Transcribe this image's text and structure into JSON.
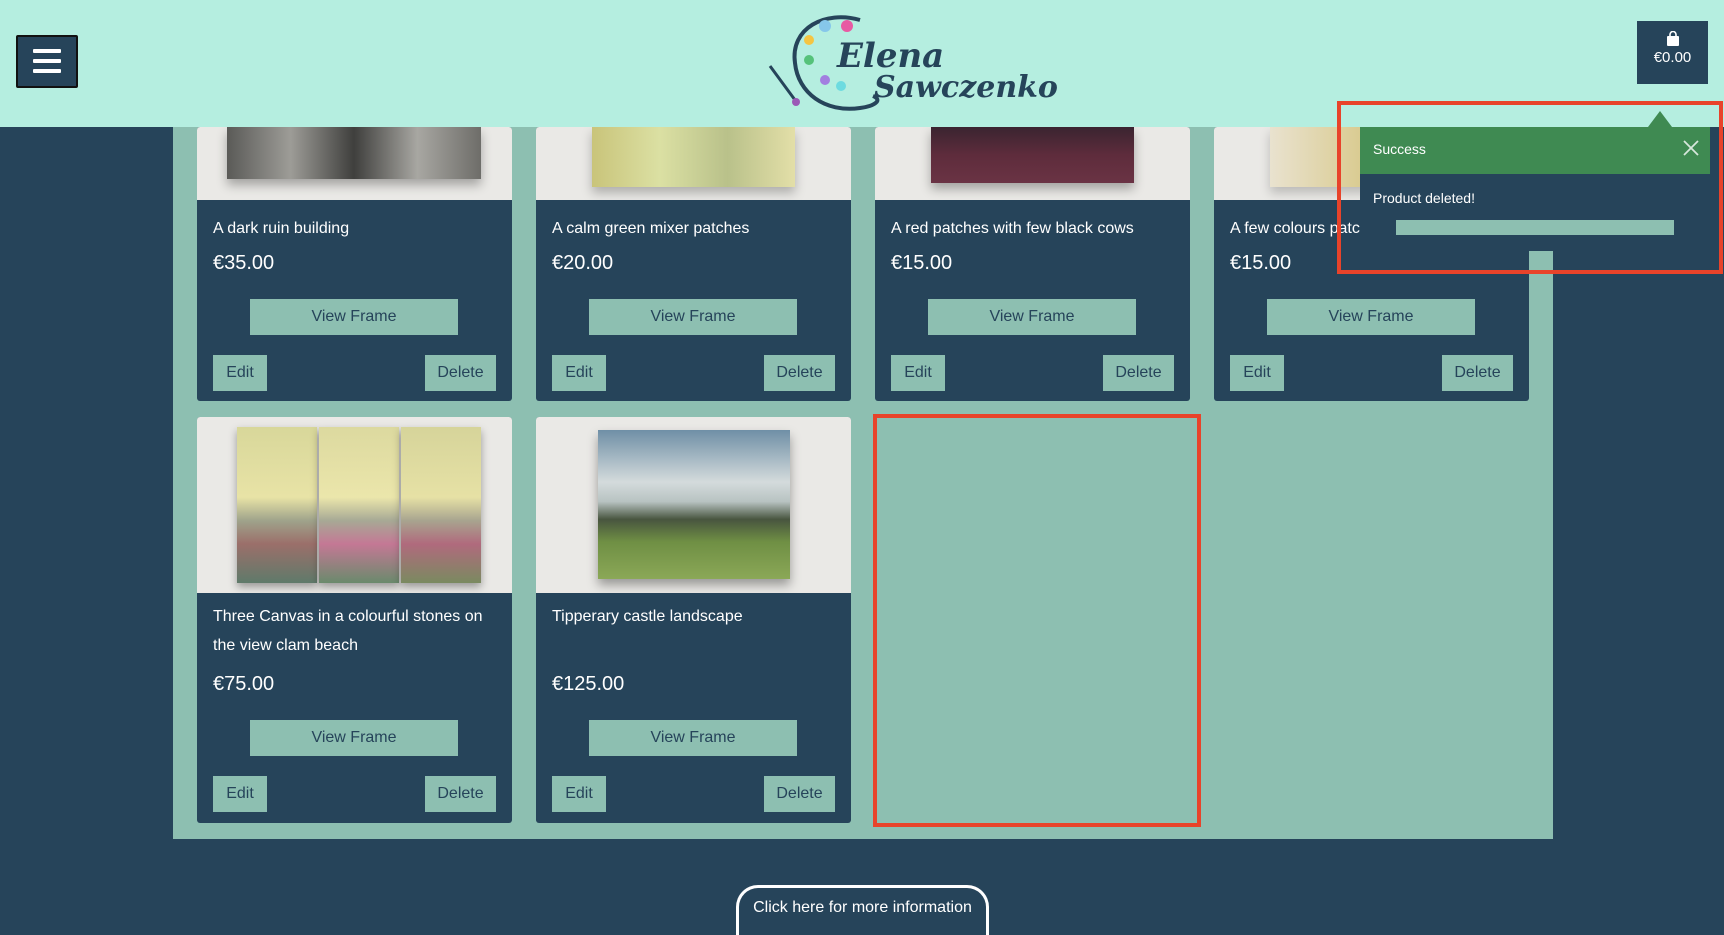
{
  "header": {
    "logo_line1": "Elena",
    "logo_line2": "Sawczenko",
    "cart_total": "€0.00",
    "icons": [
      "menu-icon",
      "shopping-bag-icon",
      "palette-icon"
    ]
  },
  "products": [
    {
      "title": "A dark ruin building",
      "price": "€35.00",
      "view_label": "View Frame",
      "edit_label": "Edit",
      "delete_label": "Delete"
    },
    {
      "title": "A calm green mixer patches",
      "price": "€20.00",
      "view_label": "View Frame",
      "edit_label": "Edit",
      "delete_label": "Delete"
    },
    {
      "title": "A red patches with few black cows",
      "price": "€15.00",
      "view_label": "View Frame",
      "edit_label": "Edit",
      "delete_label": "Delete"
    },
    {
      "title": "A few colours patc",
      "price": "€15.00",
      "view_label": "View Frame",
      "edit_label": "Edit",
      "delete_label": "Delete"
    },
    {
      "title": "Three Canvas in a colourful stones on the view clam beach",
      "price": "€75.00",
      "view_label": "View Frame",
      "edit_label": "Edit",
      "delete_label": "Delete"
    },
    {
      "title": "Tipperary castle landscape",
      "price": "€125.00",
      "view_label": "View Frame",
      "edit_label": "Edit",
      "delete_label": "Delete"
    }
  ],
  "toast": {
    "title": "Success",
    "message": "Product deleted!"
  },
  "footer": {
    "info_label": "Click here for more information"
  },
  "colors": {
    "header_bg": "#b5eee0",
    "navy": "#26445a",
    "teal": "#8dbfb1",
    "success": "#3f8a52",
    "highlight": "#e8432a"
  }
}
